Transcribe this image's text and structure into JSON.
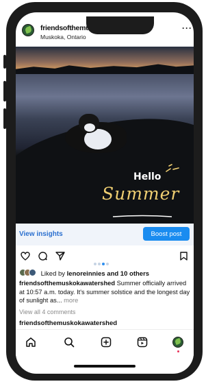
{
  "post": {
    "username": "friendsofthemuskokawatershed",
    "location": "Muskoka, Ontario",
    "more_icon": "more-horizontal-icon"
  },
  "photo": {
    "overlay_hello": "Hello",
    "overlay_summer": "Summer"
  },
  "insights": {
    "view_label": "View insights",
    "boost_label": "Boost post",
    "boost_color": "#1a8cf0"
  },
  "actions": {
    "icons": [
      "heart-icon",
      "comment-icon",
      "share-icon",
      "bookmark-icon"
    ],
    "carousel_count": 4,
    "carousel_active": 3
  },
  "likes": {
    "prefix": "Liked by ",
    "user": "lenoreinnies",
    "suffix": " and 10 others"
  },
  "caption": {
    "username": "friendsofthemuskokawatershed",
    "text": " Summer officially arrived at 10:57 a.m. today. It's summer solstice and the longest day of sunlight as...",
    "more": " more"
  },
  "comments": {
    "view_all": "View all 4 comments",
    "next_username": "friendsofthemuskokawatershed"
  },
  "nav": {
    "icons": [
      "home-icon",
      "search-icon",
      "add-post-icon",
      "reels-icon",
      "profile-avatar"
    ]
  }
}
